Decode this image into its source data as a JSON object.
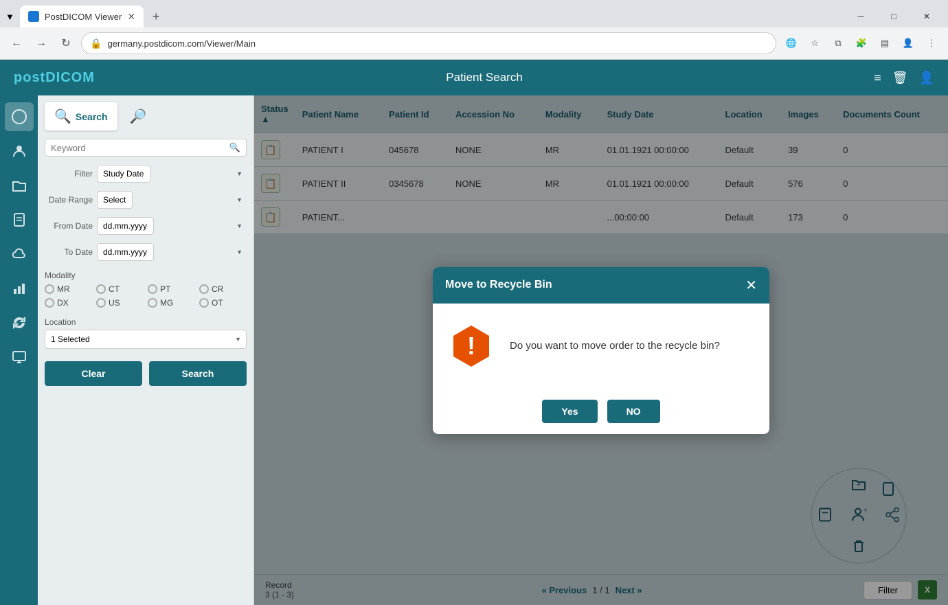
{
  "browser": {
    "tab_title": "PostDICOM Viewer",
    "url": "germany.postdicom.com/Viewer/Main",
    "new_tab_symbol": "+",
    "dropdown_symbol": "▼"
  },
  "header": {
    "logo_pre": "post",
    "logo_post": "DICOM",
    "title": "Patient Search",
    "icon_list": "≡",
    "icon_recycle": "🗑",
    "icon_user": "👤"
  },
  "sidebar": {
    "icons": [
      "🔵",
      "👤",
      "📁",
      "📋",
      "☁",
      "📊",
      "🔄",
      "🖥"
    ]
  },
  "search_panel": {
    "tab1_label": "Search",
    "tab2_label": "",
    "keyword_placeholder": "Keyword",
    "filter_label": "Filter",
    "filter_value": "Study Date",
    "date_range_label": "Date Range",
    "date_range_value": "Select",
    "from_date_label": "From Date",
    "from_date_value": "dd.mm.yyyy",
    "to_date_label": "To Date",
    "to_date_value": "dd.mm.yyyy",
    "modality_label": "Modality",
    "modalities": [
      "MR",
      "CT",
      "PT",
      "CR",
      "DX",
      "US",
      "MG",
      "OT"
    ],
    "location_label": "Location",
    "location_value": "1 Selected",
    "clear_btn": "Clear",
    "search_btn": "Search"
  },
  "table": {
    "columns": [
      "Status",
      "Patient Name",
      "Patient Id",
      "Accession No",
      "Modality",
      "Study Date",
      "Location",
      "Images",
      "Documents Count"
    ],
    "rows": [
      {
        "status": "📋",
        "name": "PATIENT I",
        "id": "045678",
        "accession": "NONE",
        "modality": "MR",
        "date": "01.01.1921 00:00:00",
        "location": "Default",
        "images": "39",
        "docs": "0"
      },
      {
        "status": "📋",
        "name": "PATIENT II",
        "id": "0345678",
        "accession": "NONE",
        "modality": "MR",
        "date": "01.01.1921 00:00:00",
        "location": "Default",
        "images": "576",
        "docs": "0"
      },
      {
        "status": "📋",
        "name": "PATIENT...",
        "id": "...",
        "accession": "...",
        "modality": "...",
        "date": "...00:00:00",
        "location": "Default",
        "images": "173",
        "docs": "0"
      }
    ]
  },
  "footer": {
    "record_label": "Record",
    "record_value": "3 (1 - 3)",
    "prev_label": "« Previous",
    "page_info": "1 / 1",
    "next_label": "Next »",
    "filter_btn": "Filter",
    "excel_label": "X"
  },
  "modal": {
    "title": "Move to Recycle Bin",
    "message": "Do you want to move order to the recycle bin?",
    "yes_btn": "Yes",
    "no_btn": "NO",
    "close_symbol": "✕"
  },
  "colors": {
    "primary": "#1a6b7a",
    "warning_hex": "#e65100",
    "yes_btn": "#1a8fa0",
    "no_btn": "#1a8fa0"
  }
}
